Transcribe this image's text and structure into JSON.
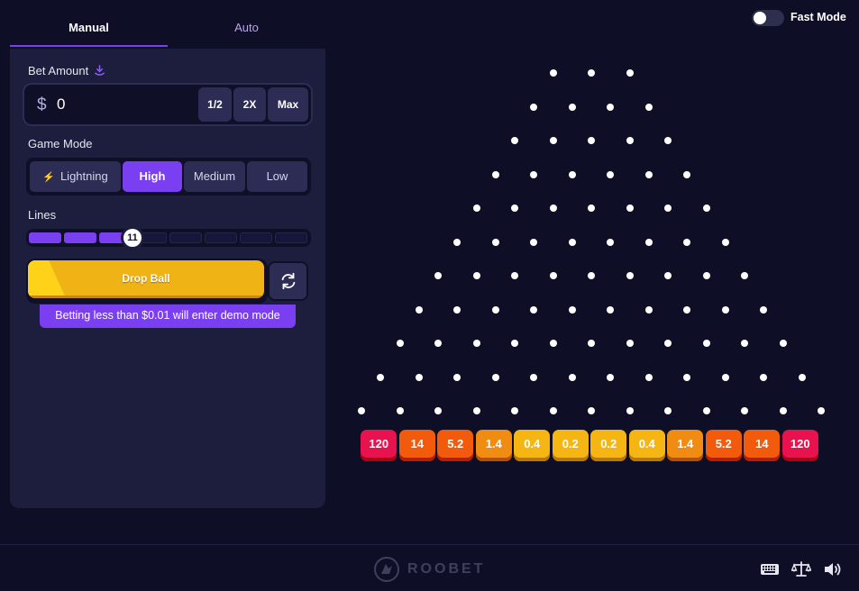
{
  "tabs": {
    "manual": "Manual",
    "auto": "Auto"
  },
  "fast_mode": {
    "label": "Fast Mode",
    "enabled": false
  },
  "bet": {
    "label": "Bet Amount",
    "currency_symbol": "$",
    "value": "0",
    "half_label": "1/2",
    "double_label": "2X",
    "max_label": "Max"
  },
  "game_mode": {
    "label": "Game Mode",
    "options": [
      "Lightning",
      "High",
      "Medium",
      "Low"
    ],
    "selected": "High"
  },
  "lines": {
    "label": "Lines",
    "value": "11",
    "min": 8,
    "max": 16
  },
  "drop_button_label": "Drop Ball",
  "demo_note": "Betting less than $0.01 will enter demo mode",
  "multipliers": [
    "120",
    "14",
    "5.2",
    "1.4",
    "0.4",
    "0.2",
    "0.2",
    "0.4",
    "1.4",
    "5.2",
    "14",
    "120"
  ],
  "colors": {
    "accent": "#7b3ff2",
    "drop_button": "#f0b316",
    "bucket_red": "#e8124f",
    "bucket_orange": "#f25a0c",
    "bucket_amber": "#f08c12",
    "bucket_yellow": "#f5b512"
  },
  "footer": {
    "logo_text": "ROOBET",
    "icons": [
      "keyboard-icon",
      "balance-scale-icon",
      "volume-icon"
    ]
  }
}
